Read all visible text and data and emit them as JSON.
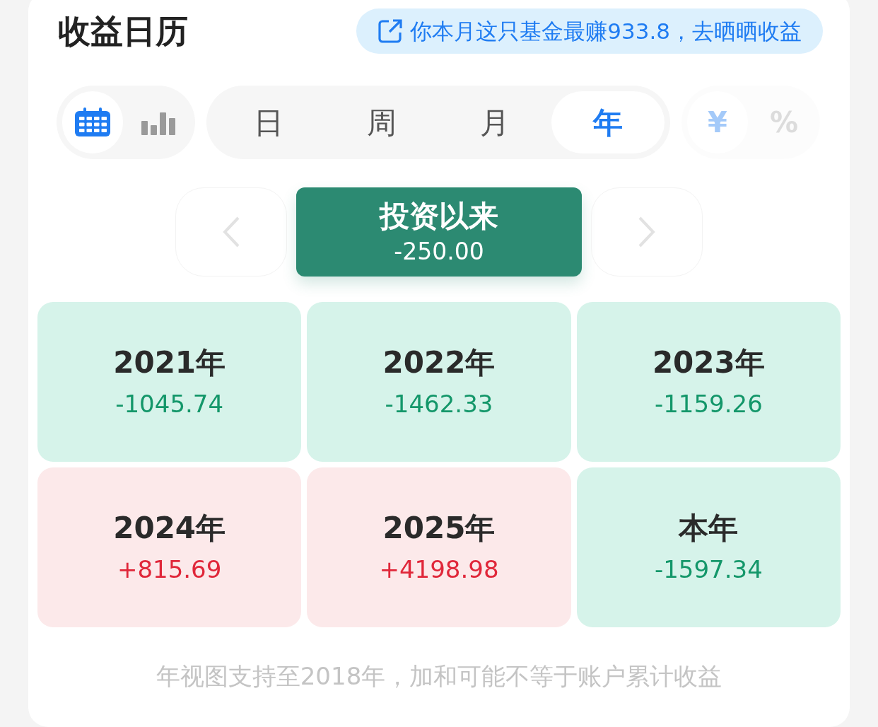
{
  "header": {
    "title": "收益日历",
    "share_banner": "你本月这只基金最赚933.8，去晒晒收益"
  },
  "view_toggle": [
    {
      "kind": "calendar",
      "selected": true
    },
    {
      "kind": "chart",
      "selected": false
    }
  ],
  "period_tabs": [
    {
      "label": "日",
      "selected": false
    },
    {
      "label": "周",
      "selected": false
    },
    {
      "label": "月",
      "selected": false
    },
    {
      "label": "年",
      "selected": true
    }
  ],
  "unit_toggle": {
    "disabled": true,
    "options": [
      {
        "label": "¥",
        "selected": true
      },
      {
        "label": "%",
        "selected": false
      }
    ]
  },
  "navigator": {
    "prev_disabled": true,
    "next_disabled": true,
    "title": "投资以来",
    "value": "-250.00"
  },
  "years": [
    {
      "label": "2021年",
      "value": "-1045.74",
      "kind": "loss"
    },
    {
      "label": "2022年",
      "value": "-1462.33",
      "kind": "loss"
    },
    {
      "label": "2023年",
      "value": "-1159.26",
      "kind": "loss"
    },
    {
      "label": "2024年",
      "value": "+815.69",
      "kind": "gain"
    },
    {
      "label": "2025年",
      "value": "+4198.98",
      "kind": "gain"
    },
    {
      "label": "本年",
      "value": "-1597.34",
      "kind": "loss"
    }
  ],
  "footnote": "年视图支持至2018年，加和可能不等于账户累计收益"
}
